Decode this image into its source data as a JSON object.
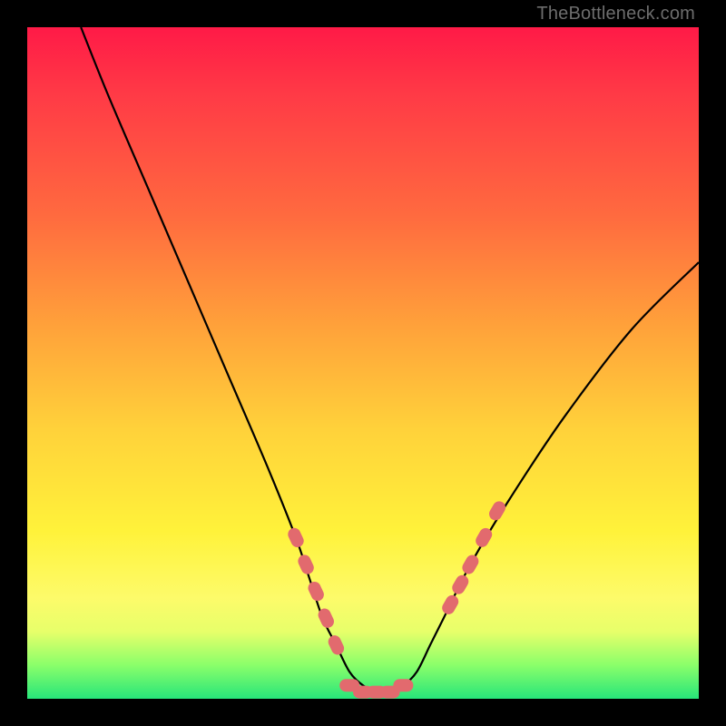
{
  "watermark": "TheBottleneck.com",
  "chart_data": {
    "type": "line",
    "title": "",
    "xlabel": "",
    "ylabel": "",
    "xlim": [
      0,
      100
    ],
    "ylim": [
      0,
      100
    ],
    "series": [
      {
        "name": "curve",
        "x": [
          8,
          12,
          18,
          24,
          30,
          36,
          40,
          42,
          44,
          46,
          48,
          50,
          52,
          54,
          56,
          58,
          60,
          62,
          66,
          72,
          80,
          90,
          100
        ],
        "y": [
          100,
          90,
          76,
          62,
          48,
          34,
          24,
          18,
          12,
          8,
          4,
          2,
          1,
          1,
          2,
          4,
          8,
          12,
          20,
          30,
          42,
          55,
          65
        ]
      }
    ],
    "annotations": {
      "left_cluster_x": [
        40,
        41.5,
        43,
        44.5,
        46
      ],
      "left_cluster_y": [
        24,
        20,
        16,
        12,
        8
      ],
      "bottom_cluster_x": [
        48,
        50,
        52,
        54,
        56
      ],
      "bottom_cluster_y": [
        2,
        1,
        1,
        1,
        2
      ],
      "right_cluster_x": [
        63,
        64.5,
        66,
        68,
        70
      ],
      "right_cluster_y": [
        14,
        17,
        20,
        24,
        28
      ]
    },
    "gradient_stops": [
      {
        "pos": 0,
        "color": "#ff1a47"
      },
      {
        "pos": 28,
        "color": "#ff6a3f"
      },
      {
        "pos": 60,
        "color": "#ffd23a"
      },
      {
        "pos": 85,
        "color": "#fdfb6a"
      },
      {
        "pos": 100,
        "color": "#27e57a"
      }
    ]
  }
}
